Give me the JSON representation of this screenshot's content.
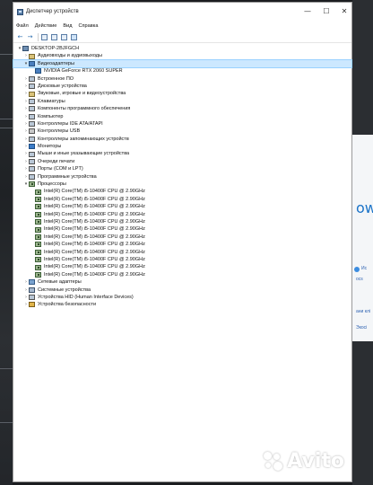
{
  "window": {
    "title": "Диспетчер устройств",
    "controls": {
      "minimize": "—",
      "maximize": "☐",
      "close": "✕"
    }
  },
  "menu": [
    "Файл",
    "Действие",
    "Вид",
    "Справка"
  ],
  "toolbar": [
    "back-arrow",
    "forward-arrow",
    "properties",
    "help",
    "update-driver",
    "scan-hardware"
  ],
  "tree": {
    "root": "DESKTOP-2BJFGCH",
    "categories": [
      {
        "label": "Аудиовходы и аудиовыходы",
        "expanded": false,
        "icon": "sound-icon"
      },
      {
        "label": "Видеоадаптеры",
        "expanded": true,
        "icon": "display-adapter-icon",
        "children": [
          "NVIDIA GeForce RTX 2060 SUPER"
        ]
      },
      {
        "label": "Встроенное ПО",
        "expanded": false,
        "icon": "firmware-icon"
      },
      {
        "label": "Дисковые устройства",
        "expanded": false,
        "icon": "disk-icon"
      },
      {
        "label": "Звуковые, игровые и видеоустройства",
        "expanded": false,
        "icon": "sound-icon"
      },
      {
        "label": "Клавиатуры",
        "expanded": false,
        "icon": "keyboard-icon"
      },
      {
        "label": "Компоненты программного обеспечения",
        "expanded": false,
        "icon": "software-component-icon"
      },
      {
        "label": "Компьютер",
        "expanded": false,
        "icon": "computer-icon"
      },
      {
        "label": "Контроллеры IDE ATA/ATAPI",
        "expanded": false,
        "icon": "ide-controller-icon"
      },
      {
        "label": "Контроллеры USB",
        "expanded": false,
        "icon": "usb-icon"
      },
      {
        "label": "Контроллеры запоминающих устройств",
        "expanded": false,
        "icon": "storage-controller-icon"
      },
      {
        "label": "Мониторы",
        "expanded": false,
        "icon": "monitor-icon"
      },
      {
        "label": "Мыши и иные указывающие устройства",
        "expanded": false,
        "icon": "mouse-icon"
      },
      {
        "label": "Очереди печати",
        "expanded": false,
        "icon": "printer-icon"
      },
      {
        "label": "Порты (COM и LPT)",
        "expanded": false,
        "icon": "port-icon"
      },
      {
        "label": "Программные устройства",
        "expanded": false,
        "icon": "software-device-icon"
      },
      {
        "label": "Процессоры",
        "expanded": true,
        "icon": "processor-icon",
        "children": [
          "Intel(R) Core(TM) i5-10400F CPU @ 2.90GHz",
          "Intel(R) Core(TM) i5-10400F CPU @ 2.90GHz",
          "Intel(R) Core(TM) i5-10400F CPU @ 2.90GHz",
          "Intel(R) Core(TM) i5-10400F CPU @ 2.90GHz",
          "Intel(R) Core(TM) i5-10400F CPU @ 2.90GHz",
          "Intel(R) Core(TM) i5-10400F CPU @ 2.90GHz",
          "Intel(R) Core(TM) i5-10400F CPU @ 2.90GHz",
          "Intel(R) Core(TM) i5-10400F CPU @ 2.90GHz",
          "Intel(R) Core(TM) i5-10400F CPU @ 2.90GHz",
          "Intel(R) Core(TM) i5-10400F CPU @ 2.90GHz",
          "Intel(R) Core(TM) i5-10400F CPU @ 2.90GHz",
          "Intel(R) Core(TM) i5-10400F CPU @ 2.90GHz"
        ]
      },
      {
        "label": "Сетевые адаптеры",
        "expanded": false,
        "icon": "network-adapter-icon"
      },
      {
        "label": "Системные устройства",
        "expanded": false,
        "icon": "system-device-icon"
      },
      {
        "label": "Устройства HID (Human Interface Devices)",
        "expanded": false,
        "icon": "hid-icon"
      },
      {
        "label": "Устройства безопасности",
        "expanded": false,
        "icon": "security-device-icon"
      }
    ]
  },
  "background": {
    "right_text_big": "ow",
    "right_text_small": [
      "Ис",
      "ocs",
      "ани клі",
      "Экосі"
    ]
  },
  "watermark": "Avito"
}
